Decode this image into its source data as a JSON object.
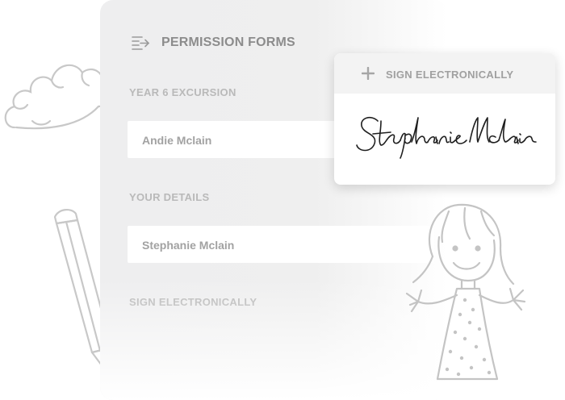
{
  "form": {
    "title": "PERMISSION FORMS",
    "sections": [
      {
        "label": "YEAR 6 EXCURSION",
        "value": "Andie Mclain"
      },
      {
        "label": "YOUR DETAILS",
        "value": "Stephanie Mclain"
      },
      {
        "label": "SIGN ELECTRONICALLY"
      }
    ]
  },
  "sign_card": {
    "title": "SIGN ELECTRONICALLY",
    "signature_text": "Stephanie Mclain"
  },
  "icons": {
    "menu": "menu-icon",
    "plus": "plus-icon",
    "cloud": "cloud-doodle",
    "pencil": "pencil-doodle",
    "girl": "girl-doodle"
  },
  "colors": {
    "panel": "#efefef",
    "label": "#b9b9b9",
    "title": "#8c8c8c",
    "doodle": "#c8c8c8"
  }
}
